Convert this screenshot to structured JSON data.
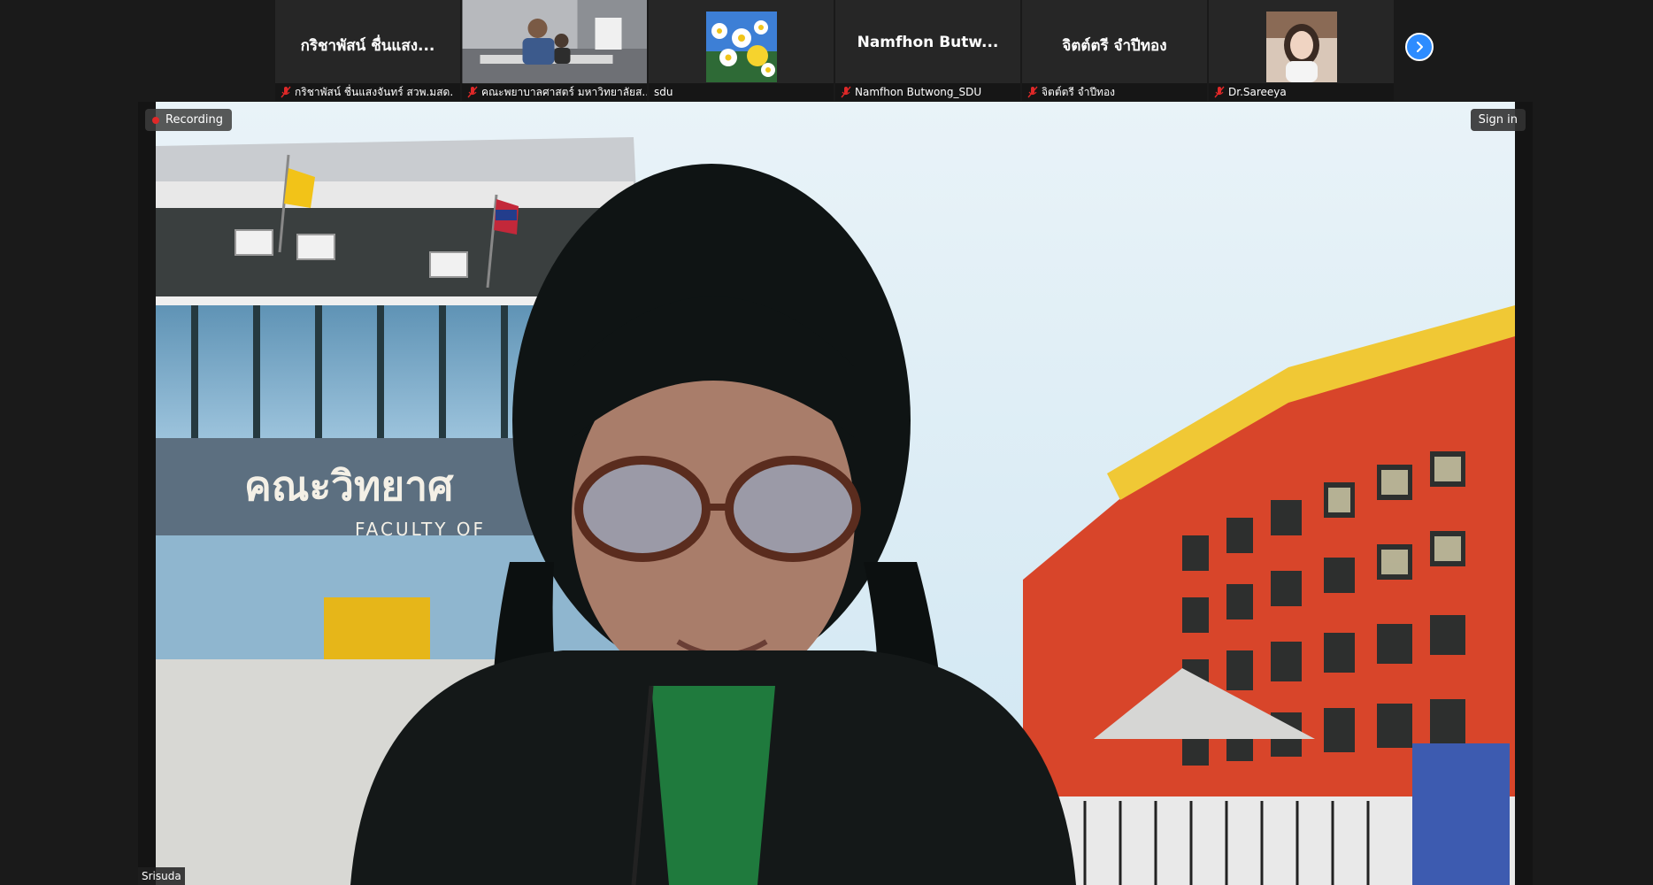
{
  "participants": [
    {
      "display_name": "กริชาพัสน์ ชื่นแสง...",
      "label": "กริชาพัสน์ ชื่นแสงจันทร์ สวพ.มสด.",
      "muted": true
    },
    {
      "display_name": "",
      "label": "คณะพยาบาลศาสตร์ มหาวิทยาลัยส...",
      "muted": true
    },
    {
      "display_name": "",
      "label": "sdu",
      "muted": false
    },
    {
      "display_name": "Namfhon Butw...",
      "label": "Namfhon Butwong_SDU",
      "muted": true
    },
    {
      "display_name": "จิตต์ตรี จำปีทอง",
      "label": "จิตต์ตรี จำปีทอง",
      "muted": true
    },
    {
      "display_name": "",
      "label": "Dr.Sareeya",
      "muted": true
    }
  ],
  "main": {
    "recording_label": "Recording",
    "sign_in_label": "Sign in",
    "speaker_name": "Srisuda",
    "sign_thai": "คณะวิทยาศ",
    "sign_english": "FACULTY OF"
  },
  "icons": {
    "mute": "mic-muted-icon",
    "next": "chevron-right-icon",
    "record": "record-dot-icon"
  },
  "colors": {
    "background": "#1a1a1a",
    "accent": "#2d8cff",
    "muted_mic": "#e02828",
    "record_dot": "#e02828"
  }
}
